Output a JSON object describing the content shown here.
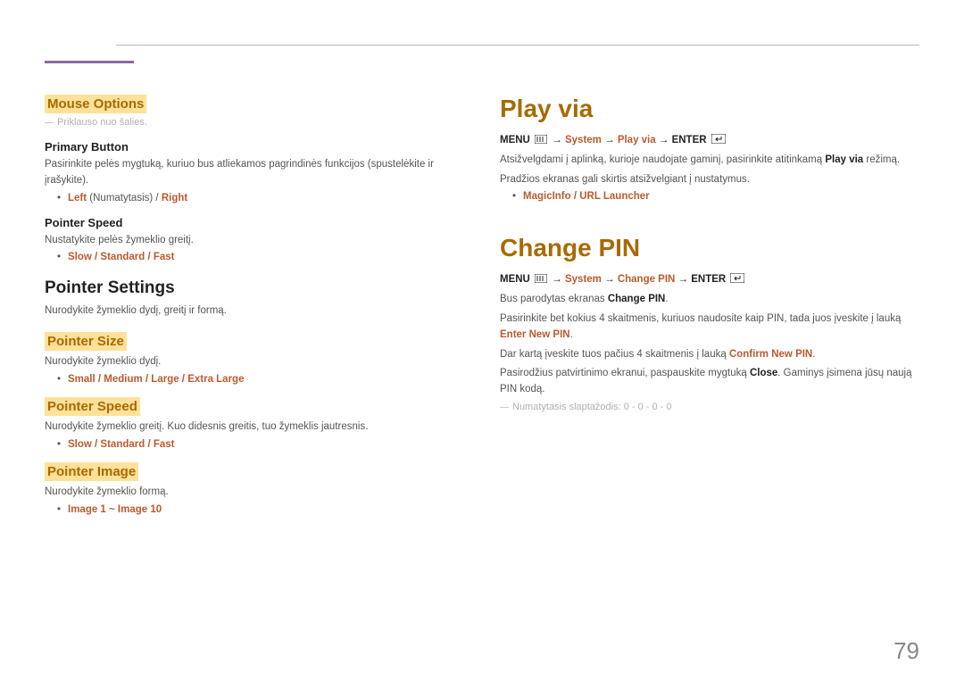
{
  "page_number": "79",
  "left": {
    "mouse_options": {
      "title": "Mouse Options",
      "note": "Priklauso nuo šalies.",
      "primary_button": {
        "title": "Primary Button",
        "desc": "Pasirinkite pelės mygtuką, kuriuo bus atliekamos pagrindinės funkcijos (spustelėkite ir įrašykite).",
        "opt_left": "Left",
        "opt_left_note": " (Numatytasis) / ",
        "opt_right": "Right"
      },
      "pointer_speed": {
        "title": "Pointer Speed",
        "desc": "Nustatykite pelės žymeklio greitį.",
        "opts": "Slow / Standard / Fast"
      }
    },
    "pointer_settings": {
      "title": "Pointer Settings",
      "desc": "Nurodykite žymeklio dydį, greitį ir formą.",
      "pointer_size": {
        "title": "Pointer Size",
        "desc": "Nurodykite žymeklio dydį.",
        "opts": "Small / Medium / Large / Extra Large"
      },
      "pointer_speed": {
        "title": "Pointer Speed",
        "desc": "Nurodykite žymeklio greitį. Kuo didesnis greitis, tuo žymeklis jautresnis.",
        "opts": "Slow / Standard / Fast"
      },
      "pointer_image": {
        "title": "Pointer Image",
        "desc": "Nurodykite žymeklio formą.",
        "opts": "Image 1 ~ Image 10"
      }
    }
  },
  "right": {
    "play_via": {
      "title": "Play via",
      "menu_label": "MENU",
      "system": "System",
      "play_via": "Play via",
      "enter": "ENTER",
      "desc1a": "Atsižvelgdami į aplinką, kurioje naudojate gaminį, pasirinkite atitinkamą ",
      "desc1b": "Play via",
      "desc1c": " režimą.",
      "desc2": "Pradžios ekranas gali skirtis atsižvelgiant į nustatymus.",
      "opts": "MagicInfo / URL Launcher"
    },
    "change_pin": {
      "title": "Change PIN",
      "menu_label": "MENU",
      "system": "System",
      "change_pin": "Change PIN",
      "enter": "ENTER",
      "line1a": "Bus parodytas ekranas ",
      "line1b": "Change PIN",
      "line1c": ".",
      "line2a": "Pasirinkite bet kokius 4 skaitmenis, kuriuos naudosite kaip PIN, tada juos įveskite į lauką ",
      "line2b": "Enter New PIN",
      "line2c": ".",
      "line3a": "Dar kartą įveskite tuos pačius 4 skaitmenis į lauką ",
      "line3b": "Confirm New PIN",
      "line3c": ".",
      "line4a": "Pasirodžius patvirtinimo ekranui, paspauskite mygtuką ",
      "line4b": "Close",
      "line4c": ". Gaminys įsimena jūsų naują PIN kodą.",
      "note": "Numatytasis slaptažodis: 0 - 0 - 0 - 0"
    }
  }
}
